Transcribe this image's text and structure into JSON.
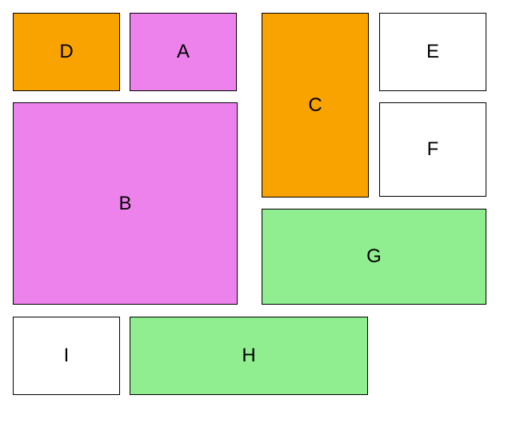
{
  "boxes": {
    "A": {
      "label": "A",
      "color": "violet"
    },
    "B": {
      "label": "B",
      "color": "violet"
    },
    "C": {
      "label": "C",
      "color": "orange"
    },
    "D": {
      "label": "D",
      "color": "orange"
    },
    "E": {
      "label": "E",
      "color": "white"
    },
    "F": {
      "label": "F",
      "color": "white"
    },
    "G": {
      "label": "G",
      "color": "green"
    },
    "H": {
      "label": "H",
      "color": "green"
    },
    "I": {
      "label": "I",
      "color": "white"
    }
  }
}
